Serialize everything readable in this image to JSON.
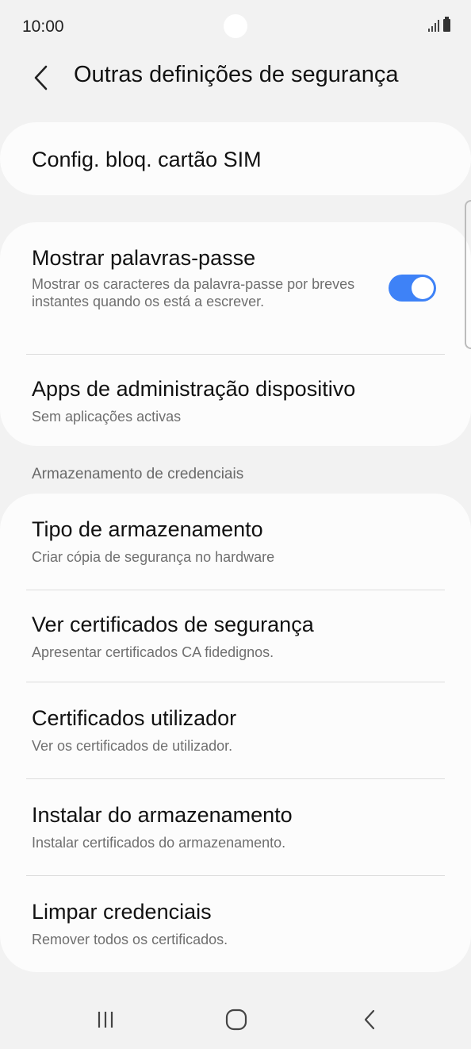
{
  "status_bar": {
    "time": "10:00"
  },
  "header": {
    "title": "Outras definições de segurança"
  },
  "sim_card": {
    "title": "Config. bloq. cartão SIM"
  },
  "passwords": {
    "title": "Mostrar palavras-passe",
    "subtitle": "Mostrar os caracteres da palavra-passe por breves instantes quando os está a escrever.",
    "toggle_on": true
  },
  "device_admin": {
    "title": "Apps de administração dispositivo",
    "subtitle": "Sem aplicações activas"
  },
  "section": {
    "label": "Armazenamento de credenciais"
  },
  "credentials": [
    {
      "title": "Tipo de armazenamento",
      "subtitle": "Criar cópia de segurança no hardware"
    },
    {
      "title": "Ver certificados de segurança",
      "subtitle": "Apresentar certificados CA fidedignos."
    },
    {
      "title": "Certificados utilizador",
      "subtitle": "Ver os certificados de utilizador."
    },
    {
      "title": "Instalar do armazenamento",
      "subtitle": "Instalar certificados do armazenamento."
    },
    {
      "title": "Limpar credenciais",
      "subtitle": "Remover todos os certificados."
    }
  ],
  "colors": {
    "accent": "#3e82f7",
    "background": "#f2f2f2",
    "card": "#fcfcfc"
  },
  "nav": {
    "icons": [
      "recent-apps-icon",
      "home-icon",
      "back-icon"
    ]
  }
}
